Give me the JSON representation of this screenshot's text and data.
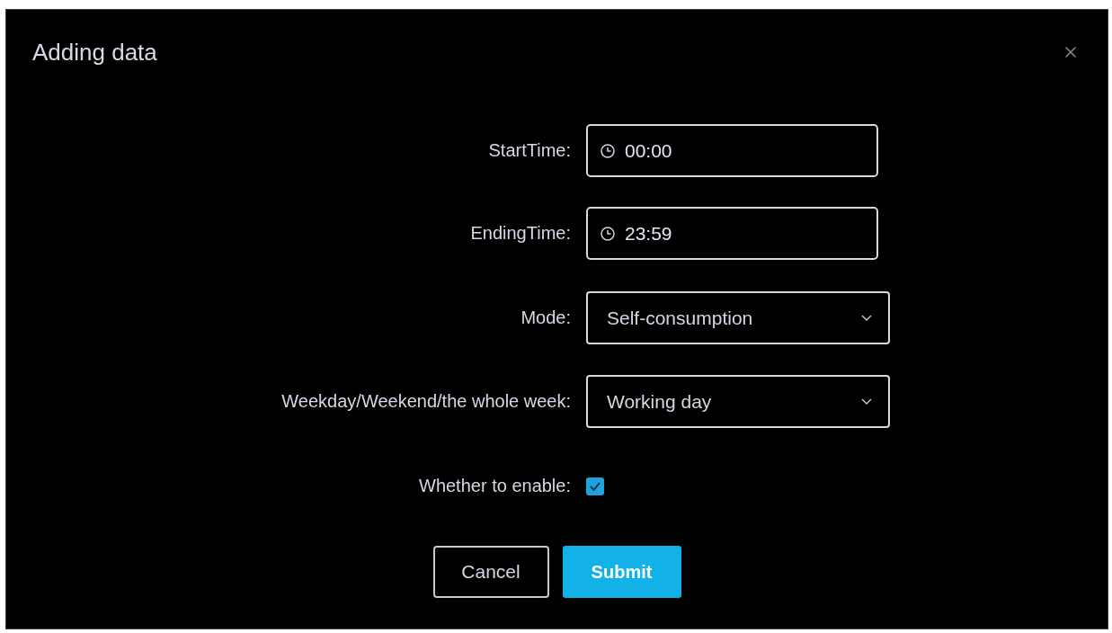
{
  "dialog": {
    "title": "Adding data"
  },
  "fields": [
    {
      "kind": "time",
      "label": "StartTime:",
      "value": "00:00"
    },
    {
      "kind": "time",
      "label": "EndingTime:",
      "value": "23:59"
    },
    {
      "kind": "select",
      "label": "Mode:",
      "value": "Self-consumption"
    },
    {
      "kind": "select",
      "label": "Weekday/Weekend/the whole week:",
      "value": "Working day"
    },
    {
      "kind": "checkbox",
      "label": "Whether to enable:",
      "checked": true
    }
  ],
  "buttons": [
    {
      "kind": "secondary",
      "label": "Cancel"
    },
    {
      "kind": "primary",
      "label": "Submit"
    }
  ]
}
